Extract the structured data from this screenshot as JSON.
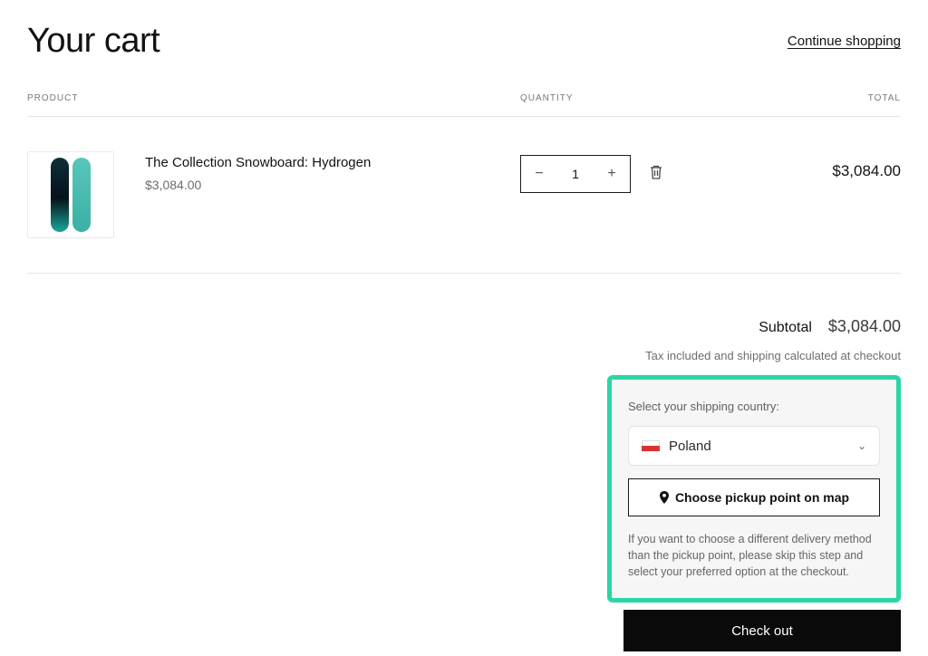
{
  "header": {
    "title": "Your cart",
    "continue": "Continue shopping"
  },
  "columns": {
    "product": "PRODUCT",
    "quantity": "QUANTITY",
    "total": "TOTAL"
  },
  "item": {
    "name": "The Collection Snowboard: Hydrogen",
    "price": "$3,084.00",
    "qty": "1",
    "line_total": "$3,084.00"
  },
  "summary": {
    "subtotal_label": "Subtotal",
    "subtotal_value": "$3,084.00",
    "tax_note": "Tax included and shipping calculated at checkout"
  },
  "panel": {
    "label": "Select your shipping country:",
    "country": "Poland",
    "map_button": "Choose pickup point on map",
    "note": "If you want to choose a different delivery method than the pickup point, please skip this step and select your preferred option at the checkout."
  },
  "checkout": "Check out"
}
